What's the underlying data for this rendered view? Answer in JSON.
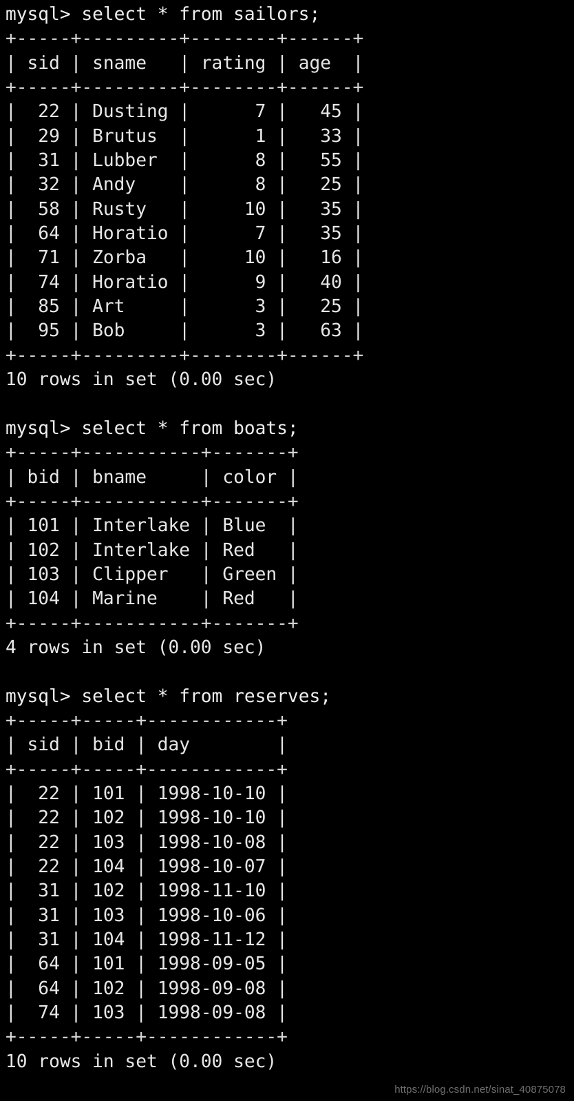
{
  "terminal": {
    "prompt": "mysql> ",
    "background_color": "#000000",
    "text_color": "#e6e6e6",
    "blocks": [
      {
        "name": "sailors",
        "command": "mysql> select * from sailors;",
        "top_rule": "+-----+---------+--------+------+",
        "header_row": "| sid | sname   | rating | age  |",
        "header_rule": "+-----+---------+--------+------+",
        "rows": [
          "|  22 | Dusting |      7 |   45 |",
          "|  29 | Brutus  |      1 |   33 |",
          "|  31 | Lubber  |      8 |   55 |",
          "|  32 | Andy    |      8 |   25 |",
          "|  58 | Rusty   |     10 |   35 |",
          "|  64 | Horatio |      7 |   35 |",
          "|  71 | Zorba   |     10 |   16 |",
          "|  74 | Horatio |      9 |   40 |",
          "|  85 | Art     |      3 |   25 |",
          "|  95 | Bob     |      3 |   63 |"
        ],
        "bottom_rule": "+-----+---------+--------+------+",
        "status": "10 rows in set (0.00 sec)",
        "columns": [
          "sid",
          "sname",
          "rating",
          "age"
        ],
        "data": [
          {
            "sid": 22,
            "sname": "Dusting",
            "rating": 7,
            "age": 45
          },
          {
            "sid": 29,
            "sname": "Brutus",
            "rating": 1,
            "age": 33
          },
          {
            "sid": 31,
            "sname": "Lubber",
            "rating": 8,
            "age": 55
          },
          {
            "sid": 32,
            "sname": "Andy",
            "rating": 8,
            "age": 25
          },
          {
            "sid": 58,
            "sname": "Rusty",
            "rating": 10,
            "age": 35
          },
          {
            "sid": 64,
            "sname": "Horatio",
            "rating": 7,
            "age": 35
          },
          {
            "sid": 71,
            "sname": "Zorba",
            "rating": 10,
            "age": 16
          },
          {
            "sid": 74,
            "sname": "Horatio",
            "rating": 9,
            "age": 40
          },
          {
            "sid": 85,
            "sname": "Art",
            "rating": 3,
            "age": 25
          },
          {
            "sid": 95,
            "sname": "Bob",
            "rating": 3,
            "age": 63
          }
        ]
      },
      {
        "name": "boats",
        "command": "mysql> select * from boats;",
        "top_rule": "+-----+-----------+-------+",
        "header_row": "| bid | bname     | color |",
        "header_rule": "+-----+-----------+-------+",
        "rows": [
          "| 101 | Interlake | Blue  |",
          "| 102 | Interlake | Red   |",
          "| 103 | Clipper   | Green |",
          "| 104 | Marine    | Red   |"
        ],
        "bottom_rule": "+-----+-----------+-------+",
        "status": "4 rows in set (0.00 sec)",
        "columns": [
          "bid",
          "bname",
          "color"
        ],
        "data": [
          {
            "bid": 101,
            "bname": "Interlake",
            "color": "Blue"
          },
          {
            "bid": 102,
            "bname": "Interlake",
            "color": "Red"
          },
          {
            "bid": 103,
            "bname": "Clipper",
            "color": "Green"
          },
          {
            "bid": 104,
            "bname": "Marine",
            "color": "Red"
          }
        ]
      },
      {
        "name": "reserves",
        "command": "mysql> select * from reserves;",
        "top_rule": "+-----+-----+------------+",
        "header_row": "| sid | bid | day        |",
        "header_rule": "+-----+-----+------------+",
        "rows": [
          "|  22 | 101 | 1998-10-10 |",
          "|  22 | 102 | 1998-10-10 |",
          "|  22 | 103 | 1998-10-08 |",
          "|  22 | 104 | 1998-10-07 |",
          "|  31 | 102 | 1998-11-10 |",
          "|  31 | 103 | 1998-10-06 |",
          "|  31 | 104 | 1998-11-12 |",
          "|  64 | 101 | 1998-09-05 |",
          "|  64 | 102 | 1998-09-08 |",
          "|  74 | 103 | 1998-09-08 |"
        ],
        "bottom_rule": "+-----+-----+------------+",
        "status": "10 rows in set (0.00 sec)",
        "columns": [
          "sid",
          "bid",
          "day"
        ],
        "data": [
          {
            "sid": 22,
            "bid": 101,
            "day": "1998-10-10"
          },
          {
            "sid": 22,
            "bid": 102,
            "day": "1998-10-10"
          },
          {
            "sid": 22,
            "bid": 103,
            "day": "1998-10-08"
          },
          {
            "sid": 22,
            "bid": 104,
            "day": "1998-10-07"
          },
          {
            "sid": 31,
            "bid": 102,
            "day": "1998-11-10"
          },
          {
            "sid": 31,
            "bid": 103,
            "day": "1998-10-06"
          },
          {
            "sid": 31,
            "bid": 104,
            "day": "1998-11-12"
          },
          {
            "sid": 64,
            "bid": 101,
            "day": "1998-09-05"
          },
          {
            "sid": 64,
            "bid": 102,
            "day": "1998-09-08"
          },
          {
            "sid": 74,
            "bid": 103,
            "day": "1998-09-08"
          }
        ]
      }
    ],
    "blank": " "
  },
  "watermark": {
    "text": "https://blog.csdn.net/sinat_40875078"
  }
}
